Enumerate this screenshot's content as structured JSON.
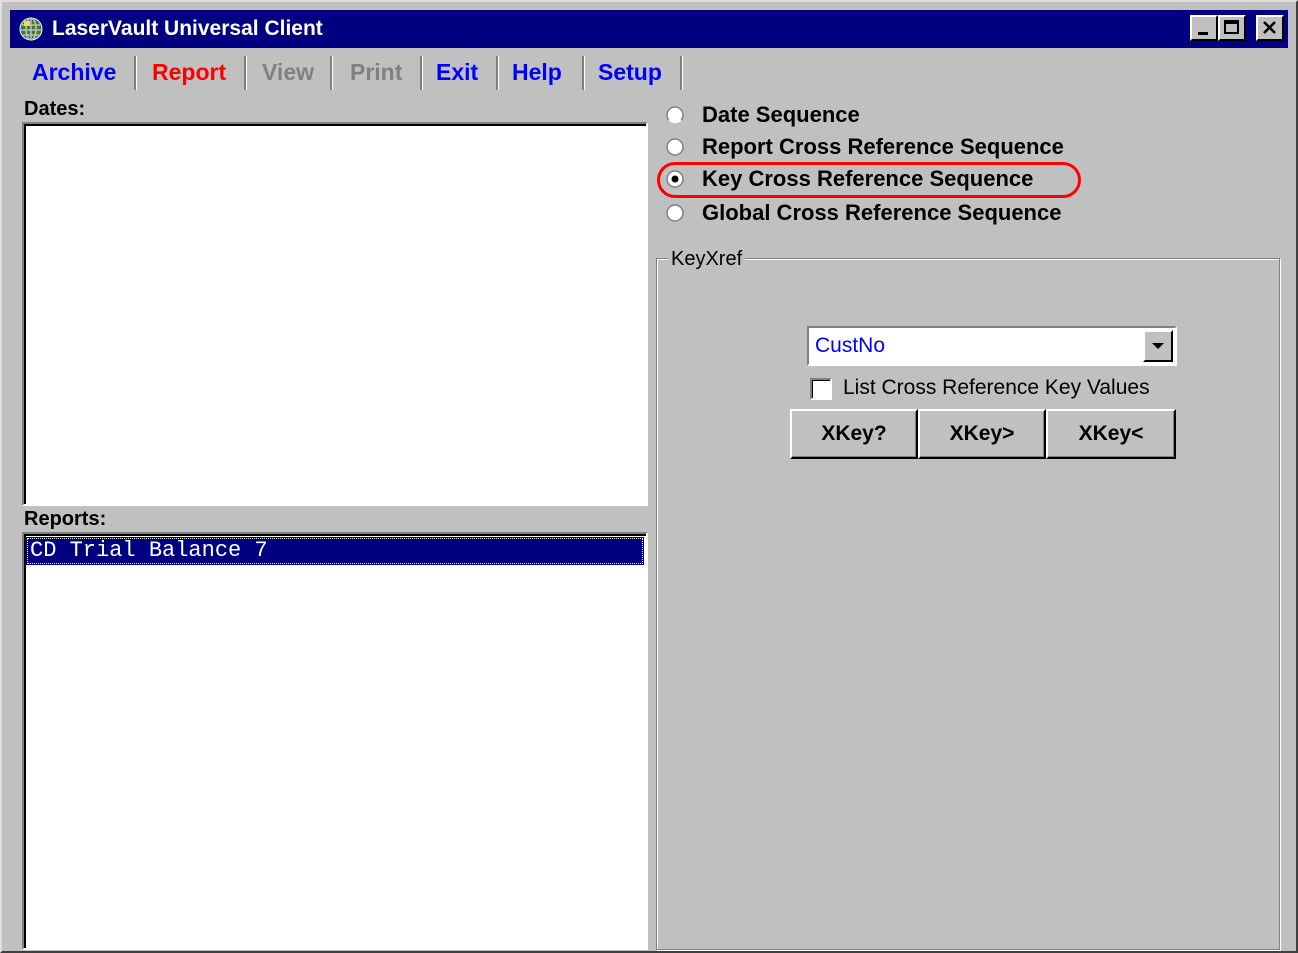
{
  "window": {
    "title": "LaserVault Universal Client"
  },
  "menu": [
    {
      "label": "Archive",
      "color": "#0000ff",
      "enabled": true
    },
    {
      "label": "Report",
      "color": "#ff0000",
      "enabled": true
    },
    {
      "label": "View",
      "color": "#808080",
      "enabled": false
    },
    {
      "label": "Print",
      "color": "#808080",
      "enabled": false
    },
    {
      "label": "Exit",
      "color": "#0000ff",
      "enabled": true
    },
    {
      "label": "Help",
      "color": "#0000ff",
      "enabled": true
    },
    {
      "label": "Setup",
      "color": "#0000ff",
      "enabled": true
    }
  ],
  "dates": {
    "label": "Dates:",
    "items": []
  },
  "reports": {
    "label": "Reports:",
    "items": [
      "CD Trial Balance 7"
    ],
    "selected_index": 0
  },
  "sequence_options": [
    {
      "label": "Date Sequence",
      "checked": false
    },
    {
      "label": "Report Cross Reference Sequence",
      "checked": false
    },
    {
      "label": "Key Cross Reference Sequence",
      "checked": true
    },
    {
      "label": "Global Cross Reference Sequence",
      "checked": false
    }
  ],
  "keyxref": {
    "group_label": "KeyXref",
    "combo_value": "CustNo",
    "checkbox_label": "List Cross Reference Key Values",
    "checkbox_checked": false,
    "buttons": [
      "XKey?",
      "XKey>",
      "XKey<"
    ]
  },
  "colors": {
    "titlebar": "#000080",
    "face": "#c0c0c0",
    "highlight_ring": "#ff0000",
    "selection": "#000080"
  }
}
